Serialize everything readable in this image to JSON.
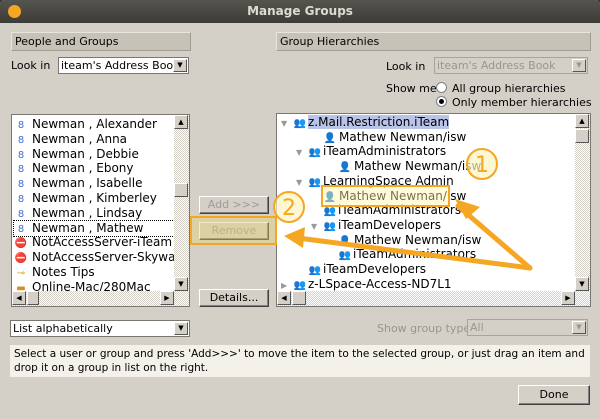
{
  "window": {
    "title": "Manage Groups"
  },
  "left": {
    "header": "People and Groups",
    "look_in_label": "Look in",
    "look_in_value": "iteam's Address Book",
    "items": [
      {
        "label": "Newman , Alexander",
        "icon": "person-icon"
      },
      {
        "label": "Newman , Anna",
        "icon": "person-icon"
      },
      {
        "label": "Newman , Debbie",
        "icon": "person-icon"
      },
      {
        "label": "Newman , Ebony",
        "icon": "person-icon"
      },
      {
        "label": "Newman , Isabelle",
        "icon": "person-icon"
      },
      {
        "label": "Newman , Kimberley",
        "icon": "person-icon"
      },
      {
        "label": "Newman , Lindsay",
        "icon": "person-icon"
      },
      {
        "label": "Newman , Mathew",
        "icon": "person-icon",
        "focused": true
      },
      {
        "label": "NotAccessServer-iTeam",
        "icon": "deny-icon"
      },
      {
        "label": "NotAccessServer-Skywalker",
        "icon": "deny-icon"
      },
      {
        "label": "Notes Tips",
        "icon": "key-icon"
      },
      {
        "label": "Online-Mac/280Mac",
        "icon": "folder-icon"
      }
    ],
    "sort_value": "List alphabetically"
  },
  "buttons": {
    "add": "Add   >>>",
    "remove": "Remove",
    "details": "Details...",
    "done": "Done"
  },
  "right": {
    "header": "Group Hierarchies",
    "look_in_label": "Look in",
    "look_in_value": "iteam's Address Book",
    "show_me_label": "Show me",
    "radio_all": "All group hierarchies",
    "radio_member": "Only member hierarchies",
    "selected_radio": "Only member hierarchies",
    "tree": [
      {
        "label": "z.Mail.Restriction.iTeam",
        "type": "group",
        "level": 0,
        "toggle": "expanded",
        "selected": true
      },
      {
        "label": "Mathew Newman/isw",
        "type": "person",
        "level": 2
      },
      {
        "label": "iTeamAdministrators",
        "type": "group",
        "level": 1,
        "toggle": "expanded"
      },
      {
        "label": "Mathew Newman/isw",
        "type": "person",
        "level": 3
      },
      {
        "label": "LearningSpace Admin",
        "type": "group",
        "level": 1,
        "toggle": "expanded"
      },
      {
        "label": "Mathew Newman/isw",
        "type": "person",
        "level": 2,
        "annotated": true
      },
      {
        "label": "iTeamAdministrators",
        "type": "group",
        "level": 2
      },
      {
        "label": "iTeamDevelopers",
        "type": "group",
        "level": 2,
        "toggle": "expanded"
      },
      {
        "label": "Mathew Newman/isw",
        "type": "person",
        "level": 3
      },
      {
        "label": "iTeamAdministrators",
        "type": "group",
        "level": 3
      },
      {
        "label": "iTeamDevelopers",
        "type": "group",
        "level": 1
      },
      {
        "label": "z-LSpace-Access-ND7L1",
        "type": "group",
        "level": 0,
        "toggle": "collapsed"
      }
    ],
    "group_type_label": "Show group type",
    "group_type_value": "All"
  },
  "info": "Select a user or group and press 'Add>>>' to move the item to the selected group, or just drag an item and drop it on a group in list on the right.",
  "annotations": {
    "step1": "1",
    "step2": "2",
    "color": "#f5a623"
  }
}
